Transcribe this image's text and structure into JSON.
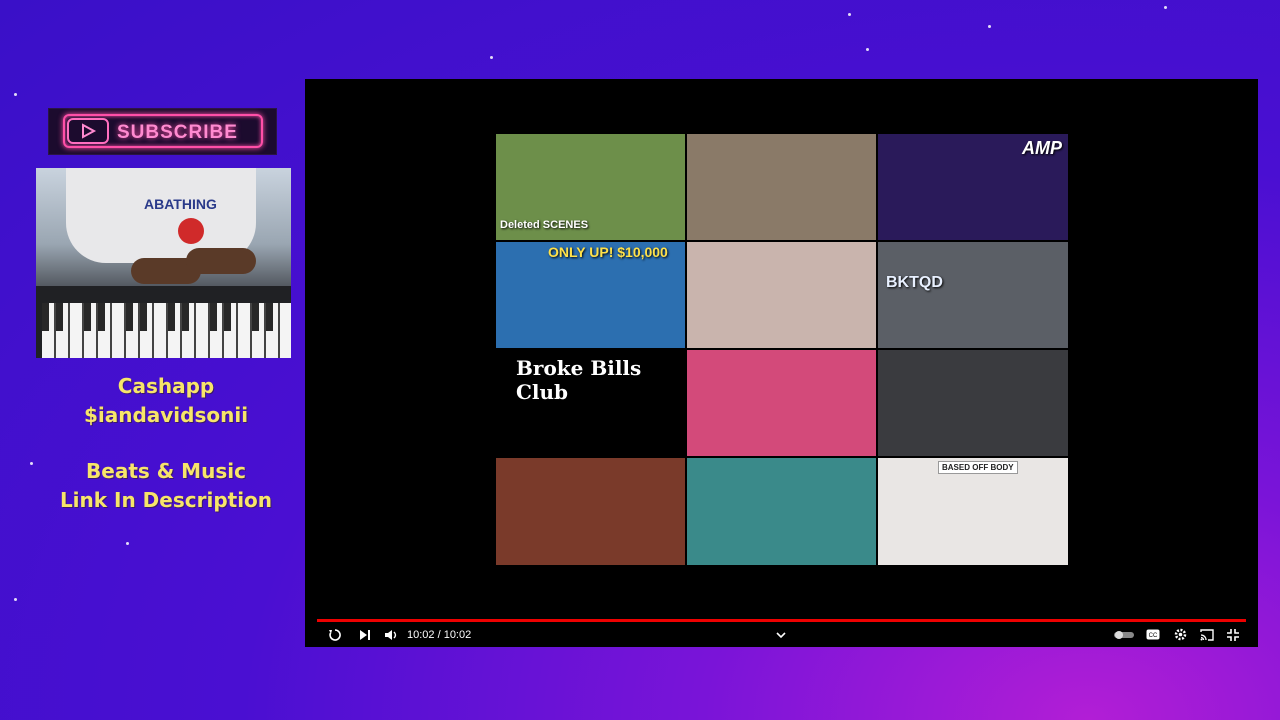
{
  "sidebar": {
    "subscribe_label": "SUBSCRIBE",
    "cashapp_title": "Cashapp",
    "cashapp_handle": "$iandavidsonii",
    "beats_line": "Beats & Music",
    "link_line": "Link In Description",
    "webcam_shirt_text": "ABATHING"
  },
  "grid": {
    "thumbnails": [
      {
        "title": "Deleted SCENES",
        "bg": "#6d8f4a"
      },
      {
        "title": "",
        "bg": "#8a7a68"
      },
      {
        "title": "AMP",
        "bg": "#2a1a5a"
      },
      {
        "title": "ONLY UP! $10,000",
        "bg": "#2c6fb0"
      },
      {
        "title": "",
        "bg": "#c9b4ad"
      },
      {
        "title": "BKTQD",
        "bg": "#5b5f66"
      },
      {
        "title": "Broke Bills Club",
        "bg": "#000000"
      },
      {
        "title": "",
        "bg": "#d34a7a"
      },
      {
        "title": "",
        "bg": "#3a3b3f"
      },
      {
        "title": "",
        "bg": "#7a3a2a"
      },
      {
        "title": "",
        "bg": "#3a8a8a"
      },
      {
        "title": "BASED OFF BODY",
        "bg": "#e9e6e4"
      }
    ]
  },
  "player": {
    "time": "10:02 / 10:02",
    "icons": {
      "replay": "replay-icon",
      "next": "next-icon",
      "volume": "volume-icon",
      "chevron": "chevron-down-icon",
      "autoplay": "autoplay-toggle",
      "captions": "captions-icon",
      "settings": "settings-gear-icon",
      "cast": "cast-icon",
      "fullscreen_exit": "fullscreen-exit-icon"
    },
    "captions_label": "CC",
    "progress_color": "#e00000"
  },
  "colors": {
    "accent_text": "#f7e56a",
    "neon_pink": "#ff4fa8"
  }
}
